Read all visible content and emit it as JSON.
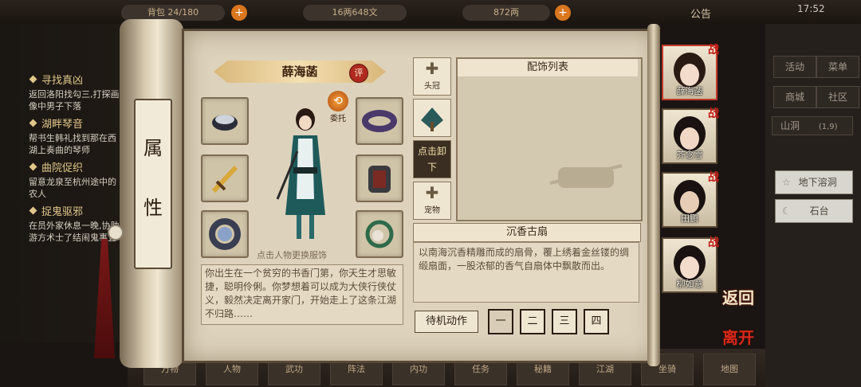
{
  "topbar": {
    "capacity_label": "背包",
    "capacity": "24/180",
    "copper": "16两648文",
    "silver": "872两",
    "announcement": "公告",
    "time": "17:52"
  },
  "quests": [
    {
      "title": "寻找真凶",
      "desc": "返回洛阳找勾三,打探画像中男子下落"
    },
    {
      "title": "湖畔琴音",
      "desc": "帮书生韩礼找到那在西湖上奏曲的琴师"
    },
    {
      "title": "曲院促织",
      "desc": "留意龙泉至杭州途中的农人"
    },
    {
      "title": "捉鬼驱邪",
      "desc": "在员外家休息一晚,协助游方术士了结闹鬼事宜"
    }
  ],
  "scroll_tab": [
    "属",
    "性"
  ],
  "character": {
    "name": "薛海菡",
    "review_label": "评",
    "entrust_label": "委托",
    "change_outfit_hint": "点击人物更换服饰",
    "bio": "你出生在一个贫穷的书香门第，你天生才思敏捷，聪明伶俐。你梦想着可以成为大侠行侠仗义，毅然决定离开家门，开始走上了这条江湖不归路……"
  },
  "equip_slots": {
    "left": [
      {
        "name": "腕饰-icon"
      },
      {
        "name": "sword-icon"
      },
      {
        "name": "bracelet-icon"
      }
    ],
    "right": [
      {
        "name": "belt-icon"
      },
      {
        "name": "armor-icon"
      },
      {
        "name": "pendant-icon"
      }
    ]
  },
  "accessory": {
    "list_title": "配饰列表",
    "headwear_label": "头冠",
    "unequip_label": "点击卸下",
    "pet_label": "宠物",
    "selected_name": "沉香古扇",
    "selected_desc": "以南海沉香精雕而成的扇骨，覆上绣着金丝镂的绸缎扇面，一股浓郁的香气自扇体中飘散而出。"
  },
  "idle_action": {
    "label": "待机动作",
    "options": [
      "一",
      "二",
      "三",
      "四"
    ]
  },
  "party": [
    {
      "name": "薛海菡",
      "badge": "战"
    },
    {
      "name": "芥念雪",
      "badge": "战"
    },
    {
      "name": "田鹏",
      "badge": "战"
    },
    {
      "name": "柳如意",
      "badge": "战"
    }
  ],
  "side_buttons": {
    "back": "返回",
    "leave": "离开"
  },
  "right_panel": {
    "buttons": [
      "活动",
      "菜单",
      "商城",
      "社区"
    ],
    "area": "山洞",
    "area_coord": "(1,9)",
    "locations": [
      "地下溶洞",
      "石台"
    ]
  },
  "dock": {
    "items": [
      "万物",
      "人物",
      "武功",
      "阵法",
      "内功",
      "任务",
      "秘籍",
      "江湖",
      "坐骑",
      "地图"
    ]
  }
}
